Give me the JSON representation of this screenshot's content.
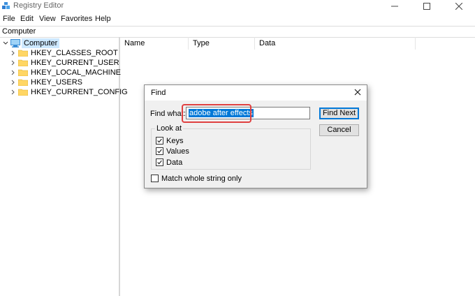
{
  "window": {
    "title": "Registry Editor",
    "icon": "registry-icon",
    "controls": [
      "minimize-icon",
      "maximize-icon",
      "close-icon"
    ]
  },
  "menu": {
    "items": [
      "File",
      "Edit",
      "View",
      "Favorites",
      "Help"
    ]
  },
  "address": {
    "path": "Computer"
  },
  "tree": {
    "root": {
      "label": "Computer",
      "icon": "computer-icon",
      "expanded": true
    },
    "keys": [
      "HKEY_CLASSES_ROOT",
      "HKEY_CURRENT_USER",
      "HKEY_LOCAL_MACHINE",
      "HKEY_USERS",
      "HKEY_CURRENT_CONFIG"
    ],
    "folder_color": "#ffd664"
  },
  "list": {
    "columns": [
      "Name",
      "Type",
      "Data"
    ]
  },
  "find_dialog": {
    "title": "Find",
    "find_what_label": "Find what:",
    "find_what_value": "adobe after effects",
    "find_next_label": "Find Next",
    "cancel_label": "Cancel",
    "look_at_label": "Look at",
    "options": [
      {
        "label": "Keys",
        "checked": true
      },
      {
        "label": "Values",
        "checked": true
      },
      {
        "label": "Data",
        "checked": true
      }
    ],
    "match_whole": {
      "label": "Match whole string only",
      "checked": false
    },
    "highlight_color": "#e04040"
  }
}
